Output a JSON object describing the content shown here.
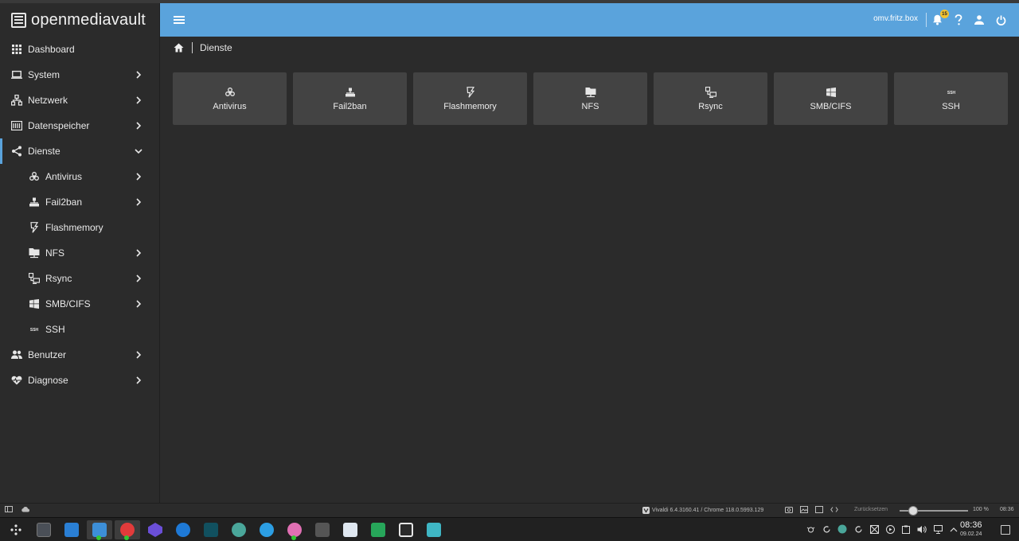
{
  "brand": {
    "name": "openmediavault"
  },
  "topbar": {
    "hostname": "omv.fritz.box",
    "notification_count": "15"
  },
  "breadcrumb": {
    "current": "Dienste"
  },
  "sidebar": {
    "items": [
      {
        "label": "Dashboard",
        "icon": "dashboard-icon"
      },
      {
        "label": "System",
        "icon": "laptop-icon"
      },
      {
        "label": "Netzwerk",
        "icon": "network-icon"
      },
      {
        "label": "Datenspeicher",
        "icon": "storage-icon"
      },
      {
        "label": "Dienste",
        "icon": "share-icon"
      },
      {
        "label": "Antivirus",
        "icon": "biohazard-icon"
      },
      {
        "label": "Fail2ban",
        "icon": "fail2ban-icon"
      },
      {
        "label": "Flashmemory",
        "icon": "flash-icon"
      },
      {
        "label": "NFS",
        "icon": "folder-network-icon"
      },
      {
        "label": "Rsync",
        "icon": "rsync-icon"
      },
      {
        "label": "SMB/CIFS",
        "icon": "windows-icon"
      },
      {
        "label": "SSH",
        "icon": "ssh-icon"
      },
      {
        "label": "Benutzer",
        "icon": "users-icon"
      },
      {
        "label": "Diagnose",
        "icon": "heart-pulse-icon"
      }
    ]
  },
  "tiles": [
    {
      "label": "Antivirus"
    },
    {
      "label": "Fail2ban"
    },
    {
      "label": "Flashmemory"
    },
    {
      "label": "NFS"
    },
    {
      "label": "Rsync"
    },
    {
      "label": "SMB/CIFS"
    },
    {
      "label": "SSH"
    }
  ],
  "statusbar": {
    "version": "Vivaldi 6.4.3160.41 / Chrome 118.0.5993.129",
    "reset_label": "Zurücksetzen",
    "zoom": "100 %",
    "time": "08:36"
  },
  "taskbar": {
    "time": "08:36",
    "date": "09.02.24"
  },
  "colors": {
    "accent": "#5aa3dc",
    "tile": "#434343",
    "background": "#2b2b2b"
  }
}
